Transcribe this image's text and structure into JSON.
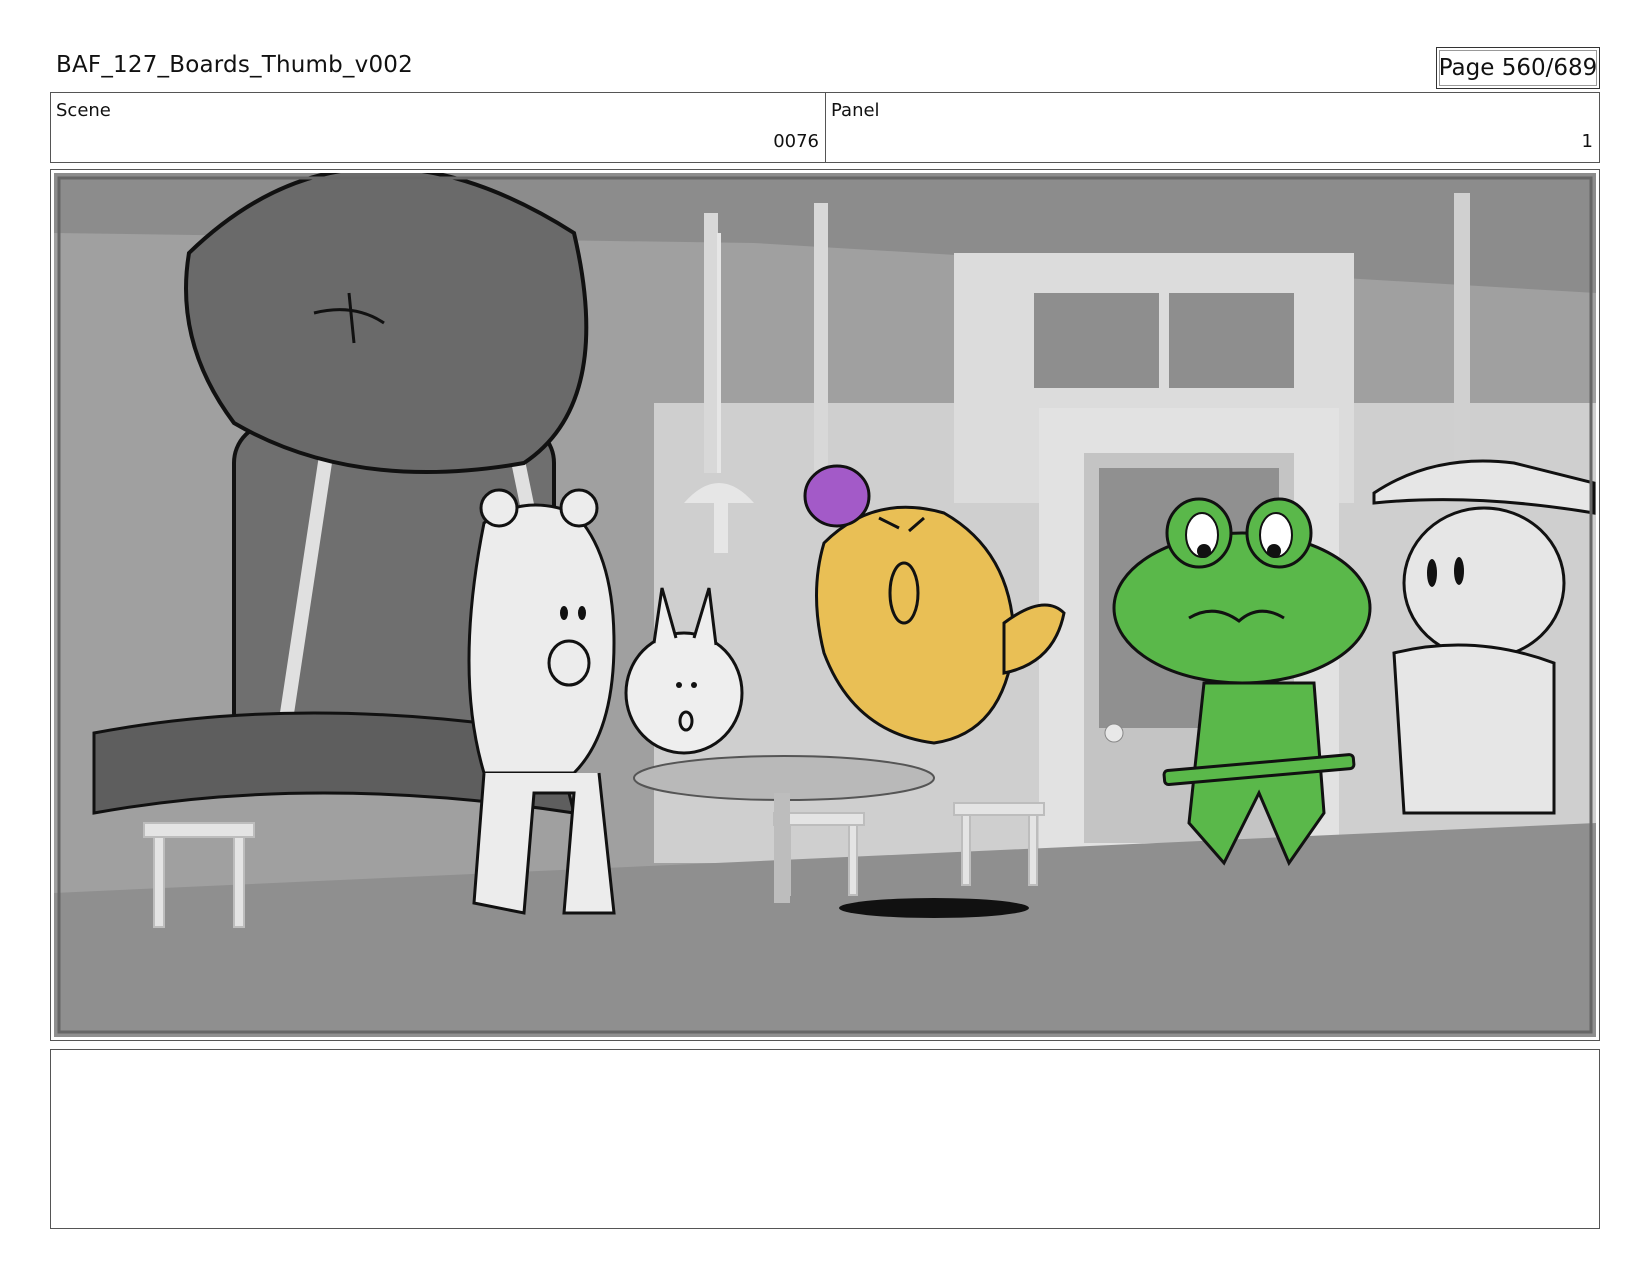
{
  "header": {
    "title": "BAF_127_Boards_Thumb_v002",
    "page": "Page 560/689"
  },
  "info": {
    "scene_label": "Scene",
    "scene_value": "0076",
    "panel_label": "Panel",
    "panel_value": "1"
  },
  "notes": {
    "text": ""
  },
  "colors": {
    "frog": "#5ab84a",
    "chick": "#e9bf55",
    "ball": "#a35ac8",
    "background": "#9b9b9b"
  }
}
